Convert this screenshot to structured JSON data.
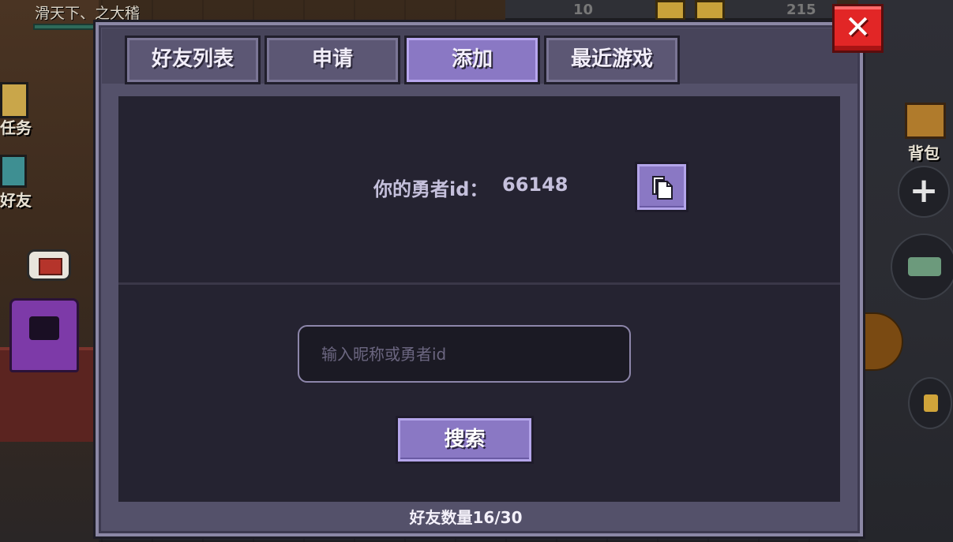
{
  "hud": {
    "player_name": "滑天下、之大稽",
    "quest_label": "任务",
    "friends_label": "好友",
    "bag_label": "背包",
    "top_value_1": "10",
    "top_value_2": "215",
    "plus_symbol": "+"
  },
  "dialog": {
    "close_symbol": "✕",
    "tabs": [
      {
        "label": "好友列表",
        "active": false
      },
      {
        "label": "申请",
        "active": false
      },
      {
        "label": "添加",
        "active": true
      },
      {
        "label": "最近游戏",
        "active": false
      }
    ],
    "hero_id_label": "你的勇者id：",
    "hero_id_value": "66148",
    "search_placeholder": "输入昵称或勇者id",
    "search_value": "",
    "search_button_label": "搜索",
    "friend_count_text": "好友数量16/30"
  },
  "colors": {
    "accent_purple": "#8a78c4",
    "panel_dark": "#252331",
    "close_red": "#e22626"
  },
  "icons": {
    "close": "close-icon",
    "copy": "copy-icon",
    "plus": "plus-icon"
  }
}
